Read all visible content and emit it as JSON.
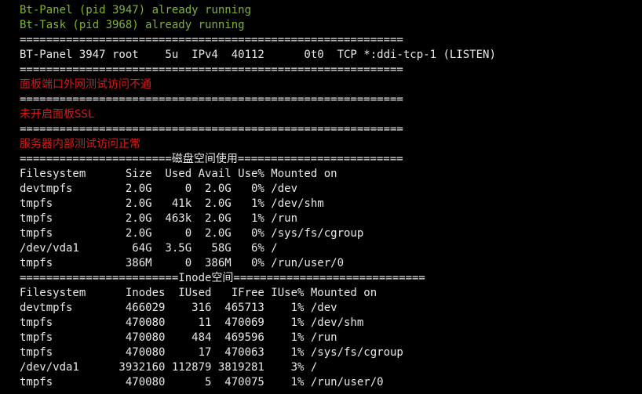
{
  "colors": {
    "background": "#000000",
    "running_green": "#7fb42e",
    "warning_red": "#d41c1c",
    "default_text": "#e8e8e8"
  },
  "terminal": {
    "lines": [
      {
        "text": "Bt-Panel (pid 3947) already running",
        "style": "green"
      },
      {
        "text": "Bt-Task (pid 3968) already running",
        "style": "green"
      },
      {
        "text": "==========================================================",
        "style": "white"
      },
      {
        "text": "BT-Panel 3947 root    5u  IPv4  40112      0t0  TCP *:ddi-tcp-1 (LISTEN)",
        "style": "white"
      },
      {
        "text": "==========================================================",
        "style": "white"
      },
      {
        "text": "面板端口外网测试访问不通",
        "style": "red"
      },
      {
        "text": "==========================================================",
        "style": "white"
      },
      {
        "text": "未开启面板SSL",
        "style": "red"
      },
      {
        "text": "==========================================================",
        "style": "white"
      },
      {
        "text": "服务器内部测试访问正常",
        "style": "red"
      },
      {
        "text": "=======================磁盘空间使用=========================",
        "style": "white"
      },
      {
        "text": "Filesystem      Size  Used Avail Use% Mounted on",
        "style": "white"
      },
      {
        "text": "devtmpfs        2.0G     0  2.0G   0% /dev",
        "style": "white"
      },
      {
        "text": "tmpfs           2.0G   41k  2.0G   1% /dev/shm",
        "style": "white"
      },
      {
        "text": "tmpfs           2.0G  463k  2.0G   1% /run",
        "style": "white"
      },
      {
        "text": "tmpfs           2.0G     0  2.0G   0% /sys/fs/cgroup",
        "style": "white"
      },
      {
        "text": "/dev/vda1        64G  3.5G   58G   6% /",
        "style": "white"
      },
      {
        "text": "tmpfs           386M     0  386M   0% /run/user/0",
        "style": "white"
      },
      {
        "text": "========================Inode空间=============================",
        "style": "white"
      },
      {
        "text": "Filesystem      Inodes  IUsed   IFree IUse% Mounted on",
        "style": "white"
      },
      {
        "text": "devtmpfs        466029    316  465713    1% /dev",
        "style": "white"
      },
      {
        "text": "tmpfs           470080     11  470069    1% /dev/shm",
        "style": "white"
      },
      {
        "text": "tmpfs           470080    484  469596    1% /run",
        "style": "white"
      },
      {
        "text": "tmpfs           470080     17  470063    1% /sys/fs/cgroup",
        "style": "white"
      },
      {
        "text": "/dev/vda1      3932160 112879 3819281    3% /",
        "style": "white"
      },
      {
        "text": "tmpfs           470080      5  470075    1% /run/user/0",
        "style": "white"
      }
    ]
  }
}
